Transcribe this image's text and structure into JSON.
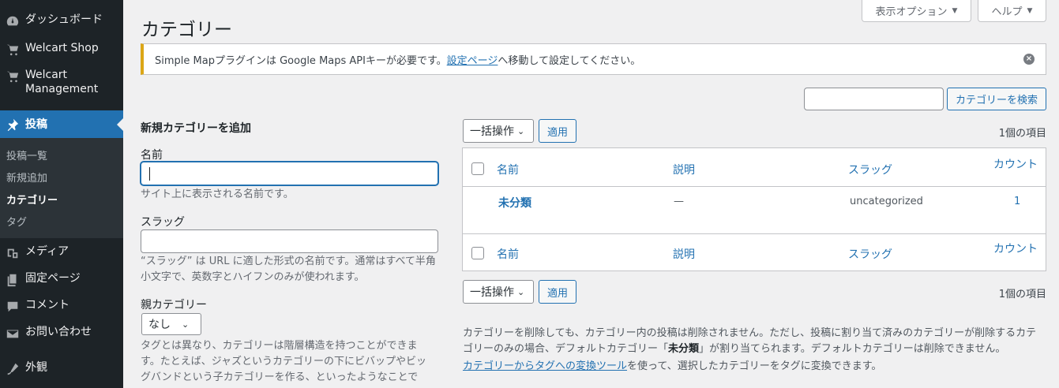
{
  "sidebar": {
    "items": [
      {
        "label": "ダッシュボード",
        "icon": "dashboard-icon"
      },
      {
        "label": "Welcart Shop",
        "icon": "cart-icon"
      },
      {
        "label": "Welcart Management",
        "icon": "cart-icon"
      },
      {
        "label": "投稿",
        "icon": "pin-icon"
      },
      {
        "label": "メディア",
        "icon": "media-icon"
      },
      {
        "label": "固定ページ",
        "icon": "pages-icon"
      },
      {
        "label": "コメント",
        "icon": "comments-icon"
      },
      {
        "label": "お問い合わせ",
        "icon": "mail-icon"
      },
      {
        "label": "外観",
        "icon": "appearance-icon"
      }
    ],
    "submenu": [
      "投稿一覧",
      "新規追加",
      "カテゴリー",
      "タグ"
    ]
  },
  "header": {
    "title": "カテゴリー",
    "screen_options": "表示オプション",
    "help": "ヘルプ"
  },
  "notice": {
    "text_before": "Simple Mapプラグインは Google Maps APIキーが必要です。",
    "link": "設定ページ",
    "text_after": "へ移動して設定してください。"
  },
  "search": {
    "placeholder": "",
    "button": "カテゴリーを検索"
  },
  "form": {
    "heading": "新規カテゴリーを追加",
    "name_label": "名前",
    "name_desc": "サイト上に表示される名前です。",
    "slug_label": "スラッグ",
    "slug_desc_1": "“スラッグ” は URL に適した形式の名前です。通常はすべて半角",
    "slug_desc_2": "小文字で、英数字とハイフンのみが使われます。",
    "parent_label": "親カテゴリー",
    "parent_value": "なし",
    "parent_desc_1": "タグとは異なり、カテゴリーは階層構造を持つことができま",
    "parent_desc_2": "す。たとえば、ジャズというカテゴリーの下にビバップやビッ",
    "parent_desc_3": "グバンドという子カテゴリーを作る、といったようなことで"
  },
  "table": {
    "bulk_label": "一括操作",
    "apply_label": "適用",
    "items_count": "1個の項目",
    "columns": {
      "name": "名前",
      "description": "説明",
      "slug": "スラッグ",
      "count": "カウント"
    },
    "rows": [
      {
        "name": "未分類",
        "description": "—",
        "slug": "uncategorized",
        "count": "1"
      }
    ]
  },
  "notes": {
    "line1": "カテゴリーを削除しても、カテゴリー内の投稿は削除されません。ただし、投稿に割り当て済みのカテゴリーが削除するカテ",
    "line2_before": "ゴリーのみの場合、デフォルトカテゴリー「",
    "line2_bold": "未分類",
    "line2_after": "」が割り当てられます。デフォルトカテゴリーは削除できません。",
    "line3_link": "カテゴリーからタグへの変換ツール",
    "line3_after": "を使って、選択したカテゴリーをタグに変換できます。"
  },
  "colors": {
    "accent": "#2271b1",
    "sidebar": "#1d2327",
    "notice_warning": "#dba617"
  }
}
